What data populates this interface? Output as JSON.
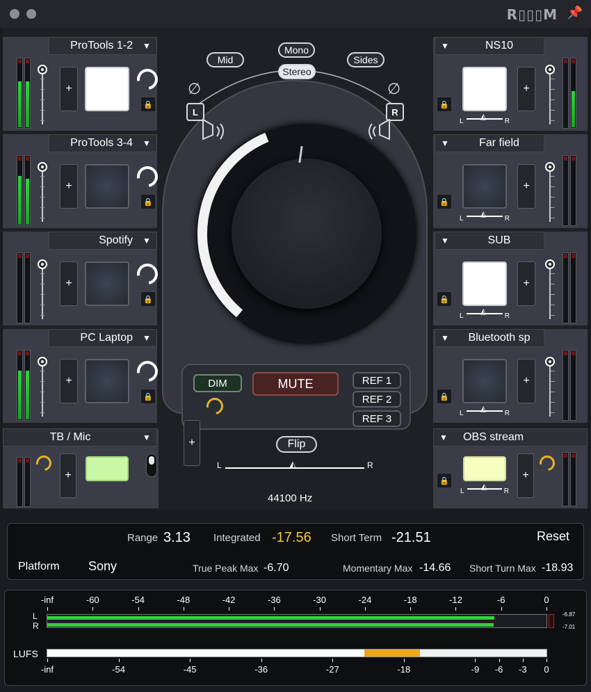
{
  "titlebar": {
    "logo": "R▯▯▯M",
    "pin_icon": "pin-icon"
  },
  "left_channels": [
    {
      "name": "ProTools 1-2",
      "pad": "on",
      "meter_l": 0.7,
      "meter_r": 0.7
    },
    {
      "name": "ProTools 3-4",
      "pad": "off",
      "meter_l": 0.75,
      "meter_r": 0.7
    },
    {
      "name": "Spotify",
      "pad": "off",
      "meter_l": 0,
      "meter_r": 0
    },
    {
      "name": "PC Laptop",
      "pad": "off",
      "meter_l": 0.75,
      "meter_r": 0.75
    }
  ],
  "right_channels": [
    {
      "name": "NS10",
      "pad": "on",
      "meter_l": 0,
      "meter_r": 0.55
    },
    {
      "name": "Far field",
      "pad": "off",
      "meter_l": 0,
      "meter_r": 0
    },
    {
      "name": "SUB",
      "pad": "on",
      "meter_l": 0,
      "meter_r": 0
    },
    {
      "name": "Bluetooth sp",
      "pad": "off",
      "meter_l": 0,
      "meter_r": 0
    }
  ],
  "talkback": {
    "name": "TB / Mic"
  },
  "obs": {
    "name": "OBS stream"
  },
  "pan_labels": {
    "left": "L",
    "right": "R"
  },
  "center": {
    "mid": "Mid",
    "mono": "Mono",
    "sides": "Sides",
    "stereo": "Stereo",
    "spk_left": "L",
    "spk_right": "R",
    "phase_glyph": "∅",
    "dim": "DIM",
    "mute": "MUTE",
    "ref1": "REF 1",
    "ref2": "REF 2",
    "ref3": "REF 3",
    "flip": "Flip",
    "pan_l": "L",
    "pan_r": "R",
    "sample_rate": "44100 Hz",
    "plus": "+",
    "volume_fraction": 0.42
  },
  "stats": {
    "range_label": "Range",
    "range_value": "3.13",
    "integrated_label": "Integrated",
    "integrated_value": "-17.56",
    "short_term_label": "Short Term",
    "short_term_value": "-21.51",
    "reset": "Reset",
    "platform_label": "Platform",
    "platform_value": "Sony",
    "true_peak_label": "True Peak Max",
    "true_peak_value": "-6.70",
    "momentary_label": "Momentary Max",
    "momentary_value": "-14.66",
    "short_turn_label": "Short Turn Max",
    "short_turn_value": "-18.93"
  },
  "meter_scale": {
    "top_ticks": [
      "-inf",
      "-60",
      "-54",
      "-48",
      "-42",
      "-36",
      "-30",
      "-24",
      "-18",
      "-12",
      "-6",
      "0"
    ],
    "L": "L",
    "R": "R",
    "l_value": "-6.87",
    "r_value": "-7.01",
    "l_level": -6.87,
    "r_level": -7.01,
    "lufs_label": "LUFS",
    "lufs_ticks": [
      "-inf",
      "-54",
      "-45",
      "-36",
      "-27",
      "-18",
      "-9",
      "-6",
      "-3",
      "0"
    ],
    "lufs_white_end": -23,
    "lufs_orange_end": -16
  },
  "colors": {
    "accent_yellow": "#f5c83a",
    "meter_green": "#2fd23c",
    "orange": "#f0a717"
  }
}
